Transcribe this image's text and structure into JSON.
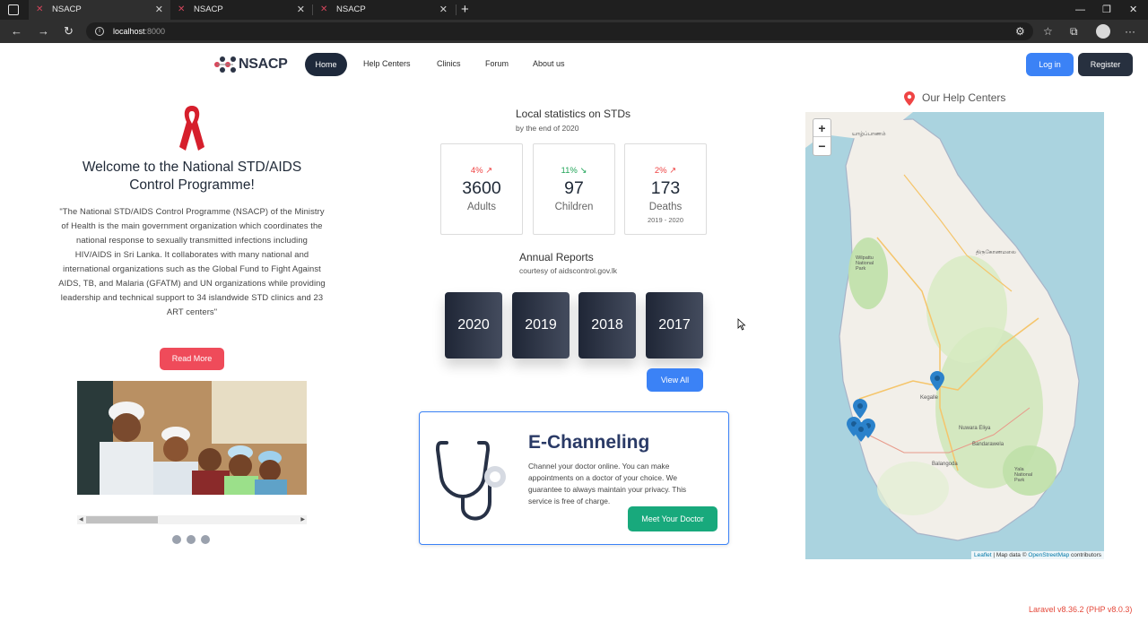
{
  "browser": {
    "tabs": [
      {
        "title": "NSACP",
        "active": true
      },
      {
        "title": "NSACP",
        "active": false
      },
      {
        "title": "NSACP",
        "active": false
      }
    ],
    "new_tab": "+",
    "url_host": "localhost",
    "url_port": ":8000"
  },
  "nav": {
    "brand": "NSACP",
    "links": [
      "Home",
      "Help Centers",
      "Clinics",
      "Forum",
      "About us"
    ],
    "login": "Log in",
    "register": "Register"
  },
  "welcome": {
    "title": "Welcome to the National STD/AIDS Control Programme!",
    "text": "\"The National STD/AIDS Control Programme (NSACP) of the Ministry of Health is the main government organization which coordinates the national response to sexually transmitted infections including HIV/AIDS in Sri Lanka. It collaborates with many national and international organizations such as the Global Fund to Fight Against AIDS, TB, and Malaria (GFATM) and UN organizations while providing leadership and technical support to 34 islandwide STD clinics and 23 ART centers\"",
    "read_more": "Read More"
  },
  "stats": {
    "title": "Local statistics on STDs",
    "subtitle": "by the end of 2020",
    "cards": [
      {
        "change": "4%",
        "trend": "up",
        "value": "3600",
        "label": "Adults",
        "note": ""
      },
      {
        "change": "11%",
        "trend": "down",
        "value": "97",
        "label": "Children",
        "note": ""
      },
      {
        "change": "2%",
        "trend": "up",
        "value": "173",
        "label": "Deaths",
        "note": "2019 - 2020"
      }
    ]
  },
  "reports": {
    "title": "Annual Reports",
    "subtitle": "courtesy of aidscontrol.gov.lk",
    "years": [
      "2020",
      "2019",
      "2018",
      "2017"
    ],
    "view_all": "View All"
  },
  "echanneling": {
    "title": "E-Channeling",
    "text": "Channel your doctor online. You can make appointments on a doctor of your choice. We guarantee to always maintain your privacy. This service is free of charge.",
    "button": "Meet Your Doctor"
  },
  "map": {
    "heading": "Our Help Centers",
    "zoom_in": "+",
    "zoom_out": "−",
    "attribution_leaflet": "Leaflet",
    "attribution_mid": " | Map data © ",
    "attribution_osm": "OpenStreetMap",
    "attribution_end": " contributors",
    "places": [
      "யாழ்ப்பாணம்",
      "Wilpattu National Park",
      "திருகோணமலை",
      "Kegalle",
      "Nuwara Eliya",
      "Bandarawela",
      "Balangoda",
      "Yala National Park"
    ]
  },
  "footer": {
    "version": "Laravel v8.36.2 (PHP v8.0.3)"
  },
  "colors": {
    "primary": "#3b82f6",
    "dark": "#1e293b",
    "danger": "#ef4b5a",
    "success": "#18a97c"
  }
}
